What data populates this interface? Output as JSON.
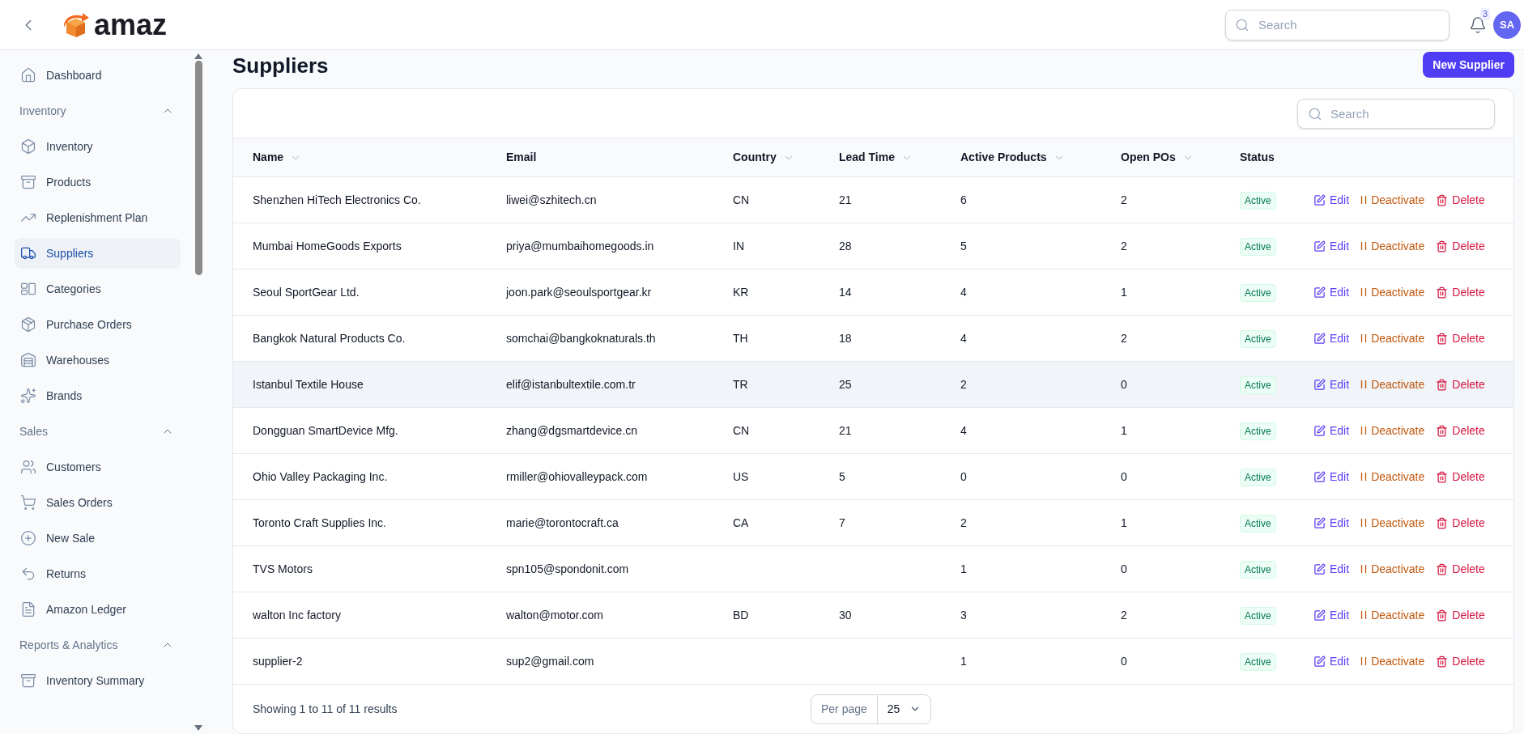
{
  "header": {
    "brand": "amaz",
    "search": {
      "placeholder": "Search"
    },
    "notifications": "3",
    "avatar": "SA"
  },
  "sidebar": {
    "items": [
      {
        "kind": "link",
        "label": "Dashboard",
        "selected": false
      },
      {
        "kind": "section",
        "label": "Inventory",
        "expanded": true,
        "children": [
          {
            "kind": "link",
            "label": "Inventory",
            "selected": false
          },
          {
            "kind": "link",
            "label": "Products",
            "selected": false
          },
          {
            "kind": "link",
            "label": "Replenishment Plan",
            "selected": false
          },
          {
            "kind": "link",
            "label": "Suppliers",
            "selected": true
          },
          {
            "kind": "link",
            "label": "Categories",
            "selected": false
          },
          {
            "kind": "link",
            "label": "Purchase Orders",
            "selected": false
          },
          {
            "kind": "link",
            "label": "Warehouses",
            "selected": false
          },
          {
            "kind": "link",
            "label": "Brands",
            "selected": false
          }
        ]
      },
      {
        "kind": "section",
        "label": "Sales",
        "expanded": true,
        "children": [
          {
            "kind": "link",
            "label": "Customers",
            "selected": false
          },
          {
            "kind": "link",
            "label": "Sales Orders",
            "selected": false
          },
          {
            "kind": "link",
            "label": "New Sale",
            "selected": false
          },
          {
            "kind": "link",
            "label": "Returns",
            "selected": false
          },
          {
            "kind": "link",
            "label": "Amazon Ledger",
            "selected": false
          }
        ]
      },
      {
        "kind": "section",
        "label": "Reports & Analytics",
        "expanded": true,
        "children": [
          {
            "kind": "link",
            "label": "Inventory Summary",
            "selected": false
          }
        ]
      }
    ]
  },
  "page": {
    "title": "Suppliers",
    "new_button": "New Supplier"
  },
  "table": {
    "search": {
      "placeholder": "Search"
    },
    "columns": [
      {
        "label": "Name",
        "sortable": true
      },
      {
        "label": "Email",
        "sortable": false
      },
      {
        "label": "Country",
        "sortable": true
      },
      {
        "label": "Lead Time",
        "sortable": true
      },
      {
        "label": "Active Products",
        "sortable": true
      },
      {
        "label": "Open POs",
        "sortable": true
      },
      {
        "label": "Status",
        "sortable": false
      }
    ],
    "rows": [
      {
        "cells": [
          "Shenzhen HiTech Electronics Co.",
          "liwei@szhitech.cn",
          "CN",
          "21",
          "6",
          "2"
        ],
        "status": "Active",
        "actions": [
          "Edit",
          "Deactivate",
          "Delete"
        ],
        "hovered": false
      },
      {
        "cells": [
          "Mumbai HomeGoods Exports",
          "priya@mumbaihomegoods.in",
          "IN",
          "28",
          "5",
          "2"
        ],
        "status": "Active",
        "actions": [
          "Edit",
          "Deactivate",
          "Delete"
        ],
        "hovered": false
      },
      {
        "cells": [
          "Seoul SportGear Ltd.",
          "joon.park@seoulsportgear.kr",
          "KR",
          "14",
          "4",
          "1"
        ],
        "status": "Active",
        "actions": [
          "Edit",
          "Deactivate",
          "Delete"
        ],
        "hovered": false
      },
      {
        "cells": [
          "Bangkok Natural Products Co.",
          "somchai@bangkoknaturals.th",
          "TH",
          "18",
          "4",
          "2"
        ],
        "status": "Active",
        "actions": [
          "Edit",
          "Deactivate",
          "Delete"
        ],
        "hovered": false
      },
      {
        "cells": [
          "Istanbul Textile House",
          "elif@istanbultextile.com.tr",
          "TR",
          "25",
          "2",
          "0"
        ],
        "status": "Active",
        "actions": [
          "Edit",
          "Deactivate",
          "Delete"
        ],
        "hovered": true
      },
      {
        "cells": [
          "Dongguan SmartDevice Mfg.",
          "zhang@dgsmartdevice.cn",
          "CN",
          "21",
          "4",
          "1"
        ],
        "status": "Active",
        "actions": [
          "Edit",
          "Deactivate",
          "Delete"
        ],
        "hovered": false
      },
      {
        "cells": [
          "Ohio Valley Packaging Inc.",
          "rmiller@ohiovalleypack.com",
          "US",
          "5",
          "0",
          "0"
        ],
        "status": "Active",
        "actions": [
          "Edit",
          "Deactivate",
          "Delete"
        ],
        "hovered": false
      },
      {
        "cells": [
          "Toronto Craft Supplies Inc.",
          "marie@torontocraft.ca",
          "CA",
          "7",
          "2",
          "1"
        ],
        "status": "Active",
        "actions": [
          "Edit",
          "Deactivate",
          "Delete"
        ],
        "hovered": false
      },
      {
        "cells": [
          "TVS Motors",
          "spn105@spondonit.com",
          "",
          "",
          "1",
          "0"
        ],
        "status": "Active",
        "actions": [
          "Edit",
          "Deactivate",
          "Delete"
        ],
        "hovered": false
      },
      {
        "cells": [
          "walton Inc factory",
          "walton@motor.com",
          "BD",
          "30",
          "3",
          "2"
        ],
        "status": "Active",
        "actions": [
          "Edit",
          "Deactivate",
          "Delete"
        ],
        "hovered": false
      },
      {
        "cells": [
          "supplier-2",
          "sup2@gmail.com",
          "",
          "",
          "1",
          "0"
        ],
        "status": "Active",
        "actions": [
          "Edit",
          "Deactivate",
          "Delete"
        ],
        "hovered": false
      }
    ],
    "summary": "Showing 1 to 11 of 11 results",
    "per_page_label": "Per page",
    "per_page": "25"
  }
}
